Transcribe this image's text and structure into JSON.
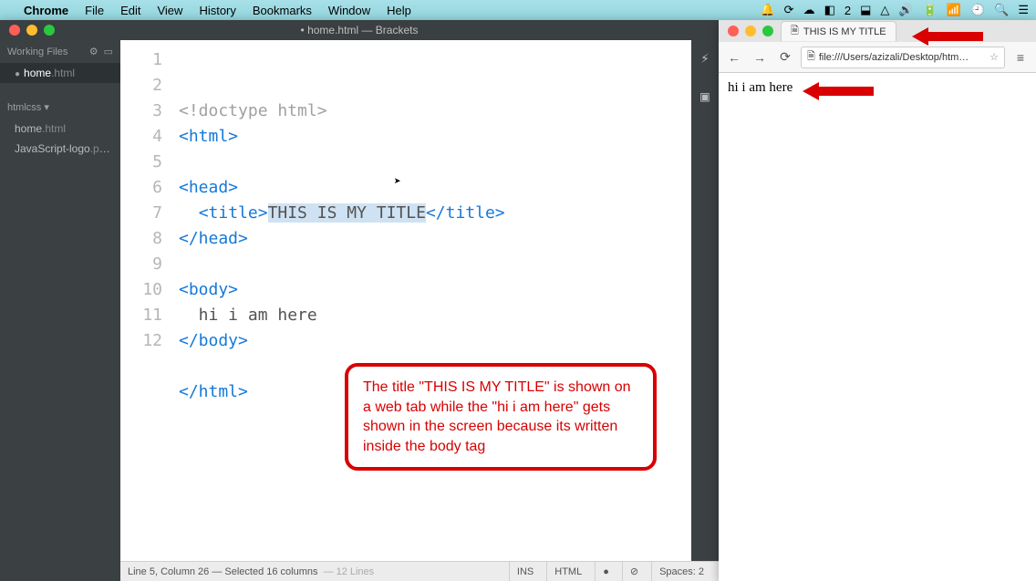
{
  "menubar": {
    "apple": "",
    "app": "Chrome",
    "items": [
      "File",
      "Edit",
      "View",
      "History",
      "Bookmarks",
      "Window",
      "Help"
    ]
  },
  "brackets": {
    "title": "• home.html — Brackets",
    "sidebar": {
      "working_files_label": "Working Files",
      "working_files": [
        {
          "name": "home",
          "ext": ".html",
          "active": true,
          "modified": true
        }
      ],
      "project_name": "htmlcss ▾",
      "project_files": [
        {
          "name": "home",
          "ext": ".html"
        },
        {
          "name": "JavaScript-logo",
          "ext": ".png"
        }
      ]
    },
    "code": {
      "lines": [
        {
          "n": 1,
          "pre": "",
          "open": "<!doctype html>",
          "cls": "doctype"
        },
        {
          "n": 2,
          "pre": "",
          "open": "<html>",
          "cls": "tag"
        },
        {
          "n": 3,
          "pre": "",
          "open": "",
          "cls": ""
        },
        {
          "n": 4,
          "pre": "",
          "open": "<head>",
          "cls": "tag"
        },
        {
          "n": 5,
          "pre": "  ",
          "open": "<title>",
          "mid": "THIS IS MY TITLE",
          "close": "</title>",
          "cls": "tag",
          "sel": true
        },
        {
          "n": 6,
          "pre": "",
          "open": "</head>",
          "cls": "tag"
        },
        {
          "n": 7,
          "pre": "",
          "open": "",
          "cls": ""
        },
        {
          "n": 8,
          "pre": "",
          "open": "<body>",
          "cls": "tag"
        },
        {
          "n": 9,
          "pre": "  ",
          "open": "hi i am here",
          "cls": ""
        },
        {
          "n": 10,
          "pre": "",
          "open": "</body>",
          "cls": "tag"
        },
        {
          "n": 11,
          "pre": "",
          "open": "",
          "cls": ""
        },
        {
          "n": 12,
          "pre": "",
          "open": "</html>",
          "cls": "tag"
        }
      ]
    },
    "status": {
      "cursor": "Line 5, Column 26 — Selected 16 columns",
      "lines": "— 12 Lines",
      "ins": "INS",
      "lang": "HTML",
      "spaces": "Spaces: 2"
    }
  },
  "chrome": {
    "tab_title": "THIS IS MY TITLE",
    "url": "file:///Users/azizali/Desktop/htm…",
    "page_text": "hi i am here"
  },
  "callout": {
    "text": "The title \"THIS IS MY TITLE\" is shown on a web tab while the \"hi i am here\" gets shown in the screen because its written inside the body tag"
  }
}
